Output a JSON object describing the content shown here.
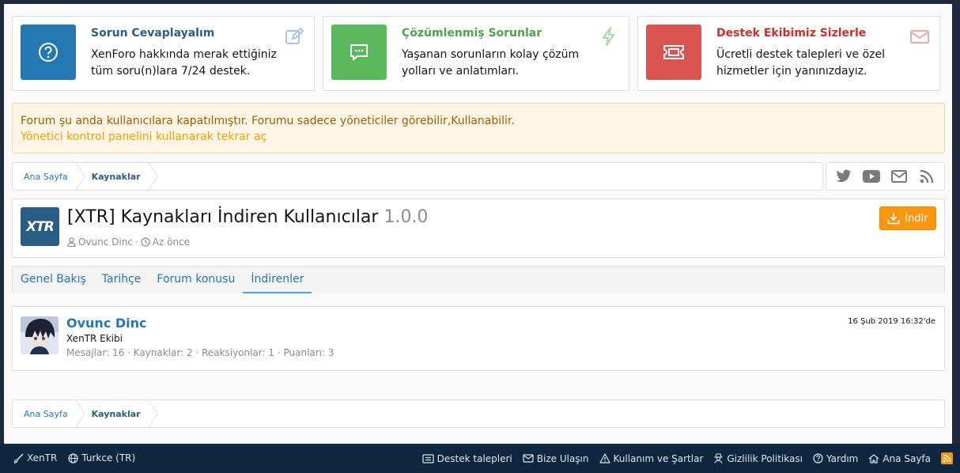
{
  "features": [
    {
      "title": "Sorun Cevaplayalım",
      "desc": "XenForo hakkında merak ettiğiniz tüm soru(n)lara 7/24 destek.",
      "color": "#2577b1",
      "title_color": "#2f5d83",
      "tile_icon": "question-icon",
      "corner_icon": "edit-icon"
    },
    {
      "title": "Çözümlenmiş Sorunlar",
      "desc": "Yaşanan sorunların kolay çözüm yolları ve anlatımları.",
      "color": "#5cb85c",
      "title_color": "#4ea24e",
      "tile_icon": "chat-icon",
      "corner_icon": "bolt-icon"
    },
    {
      "title": "Destek Ekibimiz Sizlerle",
      "desc": "Ücretli destek talepleri ve özel hizmetler için yanınızdayız.",
      "color": "#d9534f",
      "title_color": "#c9302c",
      "tile_icon": "ticket-icon",
      "corner_icon": "mail-icon"
    }
  ],
  "notice": {
    "line1": "Forum şu anda kullanıcılara kapatılmıştır. Forumu sadece yöneticiler görebilir,Kullanabilir.",
    "line2": "Yönetici kontrol panelini kullanarak tekrar aç"
  },
  "breadcrumb": {
    "home": "Ana Sayfa",
    "current": "Kaynaklar"
  },
  "social_icons": [
    "twitter-icon",
    "youtube-icon",
    "mail-icon",
    "rss-icon"
  ],
  "resource": {
    "logo_text": "XTR",
    "title": "[XTR] Kaynakları İndiren Kullanıcılar",
    "version": "1.0.0",
    "author": "Ovunc Dinc",
    "time": "Az önce",
    "download_label": "İndir"
  },
  "tabs": [
    {
      "label": "Genel Bakış",
      "active": false
    },
    {
      "label": "Tarihçe",
      "active": false
    },
    {
      "label": "Forum konusu",
      "active": false
    },
    {
      "label": "İndirenler",
      "active": true
    }
  ],
  "downloader": {
    "name": "Ovunc Dinc",
    "user_title": "XenTR Ekibi",
    "stats": "Mesajlar: 16 · Kaynaklar: 2 · Reaksiyonlar: 1 · Puanları: 3",
    "date": "16 Şub 2019 16:32'de"
  },
  "footer": {
    "left": [
      {
        "label": "XenTR",
        "icon": "brush-icon"
      },
      {
        "label": "Turkce (TR)",
        "icon": "globe-icon"
      }
    ],
    "right": [
      {
        "label": "Destek talepleri",
        "icon": "ticket-icon"
      },
      {
        "label": "Bize Ulaşın",
        "icon": "mail-icon"
      },
      {
        "label": "Kullanım ve Şartlar",
        "icon": "warning-icon"
      },
      {
        "label": "Gizlilik Politikası",
        "icon": "user-secret-icon"
      },
      {
        "label": "Yardım",
        "icon": "help-icon"
      },
      {
        "label": "Ana Sayfa",
        "icon": "home-icon"
      }
    ]
  }
}
